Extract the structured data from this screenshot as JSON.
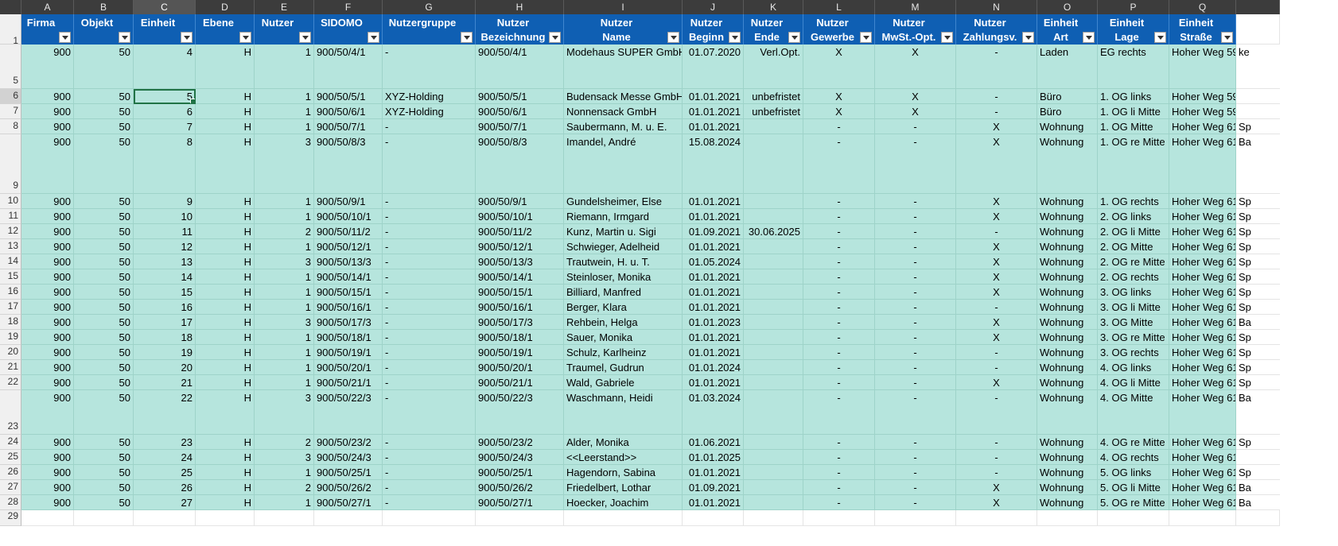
{
  "spreadsheet": {
    "columns": [
      {
        "letter": "A",
        "header": "Firma",
        "align": "ar",
        "key": "firma"
      },
      {
        "letter": "B",
        "header": "Objekt",
        "align": "ar",
        "key": "objekt"
      },
      {
        "letter": "C",
        "header": "Einheit",
        "align": "ar",
        "key": "einheit"
      },
      {
        "letter": "D",
        "header": "Ebene",
        "align": "ar",
        "key": "ebene"
      },
      {
        "letter": "E",
        "header": "Nutzer",
        "align": "ar",
        "key": "nutzer"
      },
      {
        "letter": "F",
        "header": "SIDOMO",
        "align": "al",
        "key": "sidomo"
      },
      {
        "letter": "G",
        "header": "Nutzergruppe",
        "align": "al",
        "key": "gruppe"
      },
      {
        "letter": "H",
        "header": "Nutzer\nBezeichnung",
        "align": "al",
        "key": "bez"
      },
      {
        "letter": "I",
        "header": "Nutzer\nName",
        "align": "al",
        "key": "name"
      },
      {
        "letter": "J",
        "header": "Nutzer\nBeginn",
        "align": "ar",
        "key": "beginn"
      },
      {
        "letter": "K",
        "header": "Nutzer\nEnde",
        "align": "ar",
        "key": "ende"
      },
      {
        "letter": "L",
        "header": "Nutzer\nGewerbe",
        "align": "ac",
        "key": "gewerbe"
      },
      {
        "letter": "M",
        "header": "Nutzer\nMwSt.-Opt.",
        "align": "ac",
        "key": "mwst"
      },
      {
        "letter": "N",
        "header": "Nutzer\nZahlungsv.",
        "align": "ac",
        "key": "zahlung"
      },
      {
        "letter": "O",
        "header": "Einheit\nArt",
        "align": "al",
        "key": "art"
      },
      {
        "letter": "P",
        "header": "Einheit\nLage",
        "align": "al",
        "key": "lage"
      },
      {
        "letter": "Q",
        "header": "Einheit\nStraße",
        "align": "al",
        "key": "strasse"
      },
      {
        "letter": "",
        "header": "",
        "align": "al",
        "key": "extra"
      }
    ],
    "selected_column": "C",
    "selected_row": "6",
    "rows": [
      {
        "num": "5",
        "tall": "big",
        "firma": "900",
        "objekt": "50",
        "einheit": "4",
        "ebene": "H",
        "nutzer": "1",
        "sidomo": "900/50/4/1",
        "gruppe": "-",
        "bez": "900/50/4/1",
        "name": "Modehaus SUPER GmbH",
        "beginn": "01.07.2020",
        "ende": "Verl.Opt.",
        "gewerbe": "X",
        "mwst": "X",
        "zahlung": "-",
        "art": "Laden",
        "lage": "EG rechts",
        "strasse": "Hoher Weg 59",
        "extra": "ke"
      },
      {
        "num": "6",
        "firma": "900",
        "objekt": "50",
        "einheit": "5",
        "ebene": "H",
        "nutzer": "1",
        "sidomo": "900/50/5/1",
        "gruppe": "XYZ-Holding",
        "bez": "900/50/5/1",
        "name": "Budensack Messe GmbH",
        "beginn": "01.01.2021",
        "ende": "unbefristet",
        "gewerbe": "X",
        "mwst": "X",
        "zahlung": "-",
        "art": "Büro",
        "lage": "1. OG links",
        "strasse": "Hoher Weg 59",
        "extra": ""
      },
      {
        "num": "7",
        "firma": "900",
        "objekt": "50",
        "einheit": "6",
        "ebene": "H",
        "nutzer": "1",
        "sidomo": "900/50/6/1",
        "gruppe": "XYZ-Holding",
        "bez": "900/50/6/1",
        "name": "Nonnensack GmbH",
        "beginn": "01.01.2021",
        "ende": "unbefristet",
        "gewerbe": "X",
        "mwst": "X",
        "zahlung": "-",
        "art": "Büro",
        "lage": "1. OG li Mitte",
        "strasse": "Hoher Weg 59",
        "extra": ""
      },
      {
        "num": "8",
        "firma": "900",
        "objekt": "50",
        "einheit": "7",
        "ebene": "H",
        "nutzer": "1",
        "sidomo": "900/50/7/1",
        "gruppe": "-",
        "bez": "900/50/7/1",
        "name": "Saubermann, M. u. E.",
        "beginn": "01.01.2021",
        "ende": "",
        "gewerbe": "-",
        "mwst": "-",
        "zahlung": "X",
        "art": "Wohnung",
        "lage": "1. OG Mitte",
        "strasse": "Hoher Weg 61",
        "extra": "Sp"
      },
      {
        "num": "9",
        "tall": "huge",
        "firma": "900",
        "objekt": "50",
        "einheit": "8",
        "ebene": "H",
        "nutzer": "3",
        "sidomo": "900/50/8/3",
        "gruppe": "-",
        "bez": "900/50/8/3",
        "name": "Imandel, André",
        "beginn": "15.08.2024",
        "ende": "",
        "gewerbe": "-",
        "mwst": "-",
        "zahlung": "X",
        "art": "Wohnung",
        "lage": "1. OG re Mitte",
        "strasse": "Hoher Weg 61",
        "extra": "Ba"
      },
      {
        "num": "10",
        "firma": "900",
        "objekt": "50",
        "einheit": "9",
        "ebene": "H",
        "nutzer": "1",
        "sidomo": "900/50/9/1",
        "gruppe": "-",
        "bez": "900/50/9/1",
        "name": "Gundelsheimer, Else",
        "beginn": "01.01.2021",
        "ende": "",
        "gewerbe": "-",
        "mwst": "-",
        "zahlung": "X",
        "art": "Wohnung",
        "lage": "1. OG rechts",
        "strasse": "Hoher Weg 61",
        "extra": "Sp"
      },
      {
        "num": "11",
        "firma": "900",
        "objekt": "50",
        "einheit": "10",
        "ebene": "H",
        "nutzer": "1",
        "sidomo": "900/50/10/1",
        "gruppe": "-",
        "bez": "900/50/10/1",
        "name": "Riemann, Irmgard",
        "beginn": "01.01.2021",
        "ende": "",
        "gewerbe": "-",
        "mwst": "-",
        "zahlung": "X",
        "art": "Wohnung",
        "lage": "2. OG links",
        "strasse": "Hoher Weg 61",
        "extra": "Sp"
      },
      {
        "num": "12",
        "firma": "900",
        "objekt": "50",
        "einheit": "11",
        "ebene": "H",
        "nutzer": "2",
        "sidomo": "900/50/11/2",
        "gruppe": "-",
        "bez": "900/50/11/2",
        "name": "Kunz, Martin u. Sigi",
        "beginn": "01.09.2021",
        "ende": "30.06.2025",
        "gewerbe": "-",
        "mwst": "-",
        "zahlung": "-",
        "art": "Wohnung",
        "lage": "2. OG li Mitte",
        "strasse": "Hoher Weg 61",
        "extra": "Sp"
      },
      {
        "num": "13",
        "firma": "900",
        "objekt": "50",
        "einheit": "12",
        "ebene": "H",
        "nutzer": "1",
        "sidomo": "900/50/12/1",
        "gruppe": "-",
        "bez": "900/50/12/1",
        "name": "Schwieger, Adelheid",
        "beginn": "01.01.2021",
        "ende": "",
        "gewerbe": "-",
        "mwst": "-",
        "zahlung": "X",
        "art": "Wohnung",
        "lage": "2. OG Mitte",
        "strasse": "Hoher Weg 61",
        "extra": "Sp"
      },
      {
        "num": "14",
        "firma": "900",
        "objekt": "50",
        "einheit": "13",
        "ebene": "H",
        "nutzer": "3",
        "sidomo": "900/50/13/3",
        "gruppe": "-",
        "bez": "900/50/13/3",
        "name": "Trautwein, H. u. T.",
        "beginn": "01.05.2024",
        "ende": "",
        "gewerbe": "-",
        "mwst": "-",
        "zahlung": "X",
        "art": "Wohnung",
        "lage": "2. OG re Mitte",
        "strasse": "Hoher Weg 61",
        "extra": "Sp"
      },
      {
        "num": "15",
        "firma": "900",
        "objekt": "50",
        "einheit": "14",
        "ebene": "H",
        "nutzer": "1",
        "sidomo": "900/50/14/1",
        "gruppe": "-",
        "bez": "900/50/14/1",
        "name": "Steinloser, Monika",
        "beginn": "01.01.2021",
        "ende": "",
        "gewerbe": "-",
        "mwst": "-",
        "zahlung": "X",
        "art": "Wohnung",
        "lage": "2. OG rechts",
        "strasse": "Hoher Weg 61",
        "extra": "Sp"
      },
      {
        "num": "16",
        "firma": "900",
        "objekt": "50",
        "einheit": "15",
        "ebene": "H",
        "nutzer": "1",
        "sidomo": "900/50/15/1",
        "gruppe": "-",
        "bez": "900/50/15/1",
        "name": "Billiard, Manfred",
        "beginn": "01.01.2021",
        "ende": "",
        "gewerbe": "-",
        "mwst": "-",
        "zahlung": "X",
        "art": "Wohnung",
        "lage": "3. OG links",
        "strasse": "Hoher Weg 61",
        "extra": "Sp"
      },
      {
        "num": "17",
        "firma": "900",
        "objekt": "50",
        "einheit": "16",
        "ebene": "H",
        "nutzer": "1",
        "sidomo": "900/50/16/1",
        "gruppe": "-",
        "bez": "900/50/16/1",
        "name": "Berger, Klara",
        "beginn": "01.01.2021",
        "ende": "",
        "gewerbe": "-",
        "mwst": "-",
        "zahlung": "-",
        "art": "Wohnung",
        "lage": "3. OG li Mitte",
        "strasse": "Hoher Weg 61",
        "extra": "Sp"
      },
      {
        "num": "18",
        "firma": "900",
        "objekt": "50",
        "einheit": "17",
        "ebene": "H",
        "nutzer": "3",
        "sidomo": "900/50/17/3",
        "gruppe": "-",
        "bez": "900/50/17/3",
        "name": "Rehbein, Helga",
        "beginn": "01.01.2023",
        "ende": "",
        "gewerbe": "-",
        "mwst": "-",
        "zahlung": "X",
        "art": "Wohnung",
        "lage": "3. OG Mitte",
        "strasse": "Hoher Weg 61",
        "extra": "Ba"
      },
      {
        "num": "19",
        "firma": "900",
        "objekt": "50",
        "einheit": "18",
        "ebene": "H",
        "nutzer": "1",
        "sidomo": "900/50/18/1",
        "gruppe": "-",
        "bez": "900/50/18/1",
        "name": "Sauer, Monika",
        "beginn": "01.01.2021",
        "ende": "",
        "gewerbe": "-",
        "mwst": "-",
        "zahlung": "X",
        "art": "Wohnung",
        "lage": "3. OG re Mitte",
        "strasse": "Hoher Weg 61",
        "extra": "Sp"
      },
      {
        "num": "20",
        "firma": "900",
        "objekt": "50",
        "einheit": "19",
        "ebene": "H",
        "nutzer": "1",
        "sidomo": "900/50/19/1",
        "gruppe": "-",
        "bez": "900/50/19/1",
        "name": "Schulz, Karlheinz",
        "beginn": "01.01.2021",
        "ende": "",
        "gewerbe": "-",
        "mwst": "-",
        "zahlung": "-",
        "art": "Wohnung",
        "lage": "3. OG rechts",
        "strasse": "Hoher Weg 61",
        "extra": "Sp"
      },
      {
        "num": "21",
        "firma": "900",
        "objekt": "50",
        "einheit": "20",
        "ebene": "H",
        "nutzer": "1",
        "sidomo": "900/50/20/1",
        "gruppe": "-",
        "bez": "900/50/20/1",
        "name": "Traumel, Gudrun",
        "beginn": "01.01.2024",
        "ende": "",
        "gewerbe": "-",
        "mwst": "-",
        "zahlung": "-",
        "art": "Wohnung",
        "lage": "4. OG links",
        "strasse": "Hoher Weg 61",
        "extra": "Sp"
      },
      {
        "num": "22",
        "firma": "900",
        "objekt": "50",
        "einheit": "21",
        "ebene": "H",
        "nutzer": "1",
        "sidomo": "900/50/21/1",
        "gruppe": "-",
        "bez": "900/50/21/1",
        "name": "Wald, Gabriele",
        "beginn": "01.01.2021",
        "ende": "",
        "gewerbe": "-",
        "mwst": "-",
        "zahlung": "X",
        "art": "Wohnung",
        "lage": "4. OG li Mitte",
        "strasse": "Hoher Weg 61",
        "extra": "Sp"
      },
      {
        "num": "23",
        "tall": "big",
        "firma": "900",
        "objekt": "50",
        "einheit": "22",
        "ebene": "H",
        "nutzer": "3",
        "sidomo": "900/50/22/3",
        "gruppe": "-",
        "bez": "900/50/22/3",
        "name": "Waschmann, Heidi",
        "beginn": "01.03.2024",
        "ende": "",
        "gewerbe": "-",
        "mwst": "-",
        "zahlung": "-",
        "art": "Wohnung",
        "lage": "4. OG Mitte",
        "strasse": "Hoher Weg 61",
        "extra": "Ba"
      },
      {
        "num": "24",
        "firma": "900",
        "objekt": "50",
        "einheit": "23",
        "ebene": "H",
        "nutzer": "2",
        "sidomo": "900/50/23/2",
        "gruppe": "-",
        "bez": "900/50/23/2",
        "name": "Alder, Monika",
        "beginn": "01.06.2021",
        "ende": "",
        "gewerbe": "-",
        "mwst": "-",
        "zahlung": "-",
        "art": "Wohnung",
        "lage": "4. OG re Mitte",
        "strasse": "Hoher Weg 61",
        "extra": "Sp"
      },
      {
        "num": "25",
        "firma": "900",
        "objekt": "50",
        "einheit": "24",
        "ebene": "H",
        "nutzer": "3",
        "sidomo": "900/50/24/3",
        "gruppe": "-",
        "bez": "900/50/24/3",
        "name": "<<Leerstand>>",
        "beginn": "01.01.2025",
        "ende": "",
        "gewerbe": "-",
        "mwst": "-",
        "zahlung": "-",
        "art": "Wohnung",
        "lage": "4. OG rechts",
        "strasse": "Hoher Weg 61",
        "extra": ""
      },
      {
        "num": "26",
        "firma": "900",
        "objekt": "50",
        "einheit": "25",
        "ebene": "H",
        "nutzer": "1",
        "sidomo": "900/50/25/1",
        "gruppe": "-",
        "bez": "900/50/25/1",
        "name": "Hagendorn, Sabina",
        "beginn": "01.01.2021",
        "ende": "",
        "gewerbe": "-",
        "mwst": "-",
        "zahlung": "-",
        "art": "Wohnung",
        "lage": "5. OG links",
        "strasse": "Hoher Weg 61",
        "extra": "Sp"
      },
      {
        "num": "27",
        "firma": "900",
        "objekt": "50",
        "einheit": "26",
        "ebene": "H",
        "nutzer": "2",
        "sidomo": "900/50/26/2",
        "gruppe": "-",
        "bez": "900/50/26/2",
        "name": "Friedelbert, Lothar",
        "beginn": "01.09.2021",
        "ende": "",
        "gewerbe": "-",
        "mwst": "-",
        "zahlung": "X",
        "art": "Wohnung",
        "lage": "5. OG li Mitte",
        "strasse": "Hoher Weg 61",
        "extra": "Ba"
      },
      {
        "num": "28",
        "firma": "900",
        "objekt": "50",
        "einheit": "27",
        "ebene": "H",
        "nutzer": "1",
        "sidomo": "900/50/27/1",
        "gruppe": "-",
        "bez": "900/50/27/1",
        "name": "Hoecker, Joachim",
        "beginn": "01.01.2021",
        "ende": "",
        "gewerbe": "-",
        "mwst": "-",
        "zahlung": "X",
        "art": "Wohnung",
        "lage": "5. OG re Mitte",
        "strasse": "Hoher Weg 61",
        "extra": "Ba"
      }
    ],
    "header_row_num": "1",
    "trailing_row_num": "29"
  },
  "colors": {
    "header_blue": "#0f5fb3",
    "row_fill": "#b6e5dd",
    "selection_green": "#217346"
  }
}
